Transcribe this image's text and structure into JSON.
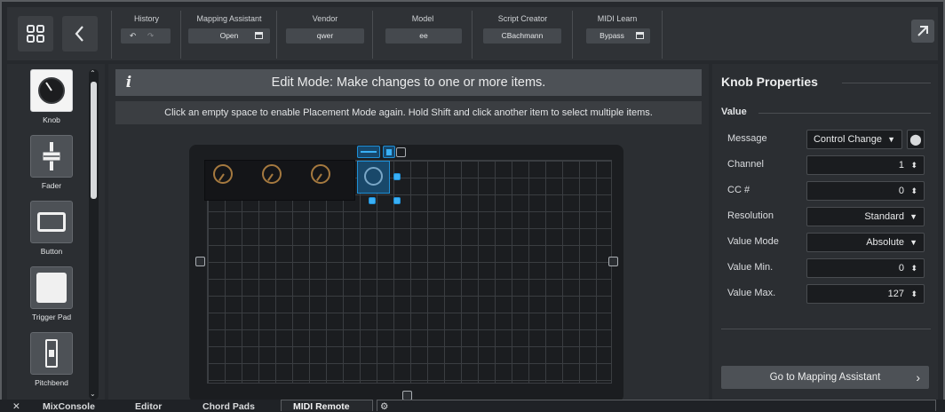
{
  "toolbar": {
    "history": {
      "title": "History",
      "undo_icon": "undo-icon",
      "redo_icon": "redo-icon"
    },
    "mapping_assistant": {
      "title": "Mapping Assistant",
      "value": "Open"
    },
    "vendor": {
      "title": "Vendor",
      "value": "qwer"
    },
    "model": {
      "title": "Model",
      "value": "ee"
    },
    "script_creator": {
      "title": "Script Creator",
      "value": "CBachmann"
    },
    "midi_learn": {
      "title": "MIDI Learn",
      "value": "Bypass"
    }
  },
  "palette": {
    "items": [
      {
        "label": "Knob",
        "icon": "knob-icon"
      },
      {
        "label": "Fader",
        "icon": "fader-icon"
      },
      {
        "label": "Button",
        "icon": "button-icon"
      },
      {
        "label": "Trigger Pad",
        "icon": "trigger-pad-icon"
      },
      {
        "label": "Pitchbend",
        "icon": "pitchbend-icon"
      }
    ]
  },
  "editor": {
    "banner_icon": "i",
    "banner_text": "Edit Mode: Make changes to one or more items.",
    "hint": "Click an empty space to enable Placement Mode again. Hold Shift and click another item to select multiple items."
  },
  "properties": {
    "title": "Knob Properties",
    "section": "Value",
    "rows": [
      {
        "label": "Message",
        "value": "Control Change",
        "control": "dropdown"
      },
      {
        "label": "Channel",
        "value": "1",
        "control": "stepper"
      },
      {
        "label": "CC #",
        "value": "0",
        "control": "stepper"
      },
      {
        "label": "Resolution",
        "value": "Standard",
        "control": "dropdown"
      },
      {
        "label": "Value Mode",
        "value": "Absolute",
        "control": "dropdown"
      },
      {
        "label": "Value Min.",
        "value": "0",
        "control": "stepper"
      },
      {
        "label": "Value Max.",
        "value": "127",
        "control": "stepper"
      }
    ],
    "goto_button": "Go to Mapping Assistant"
  },
  "tabs": [
    {
      "label": "MixConsole"
    },
    {
      "label": "Editor"
    },
    {
      "label": "Chord Pads"
    },
    {
      "label": "MIDI Remote",
      "active": true
    }
  ],
  "colors": {
    "accent": "#1e8fd6",
    "knob": "#a5793f"
  }
}
